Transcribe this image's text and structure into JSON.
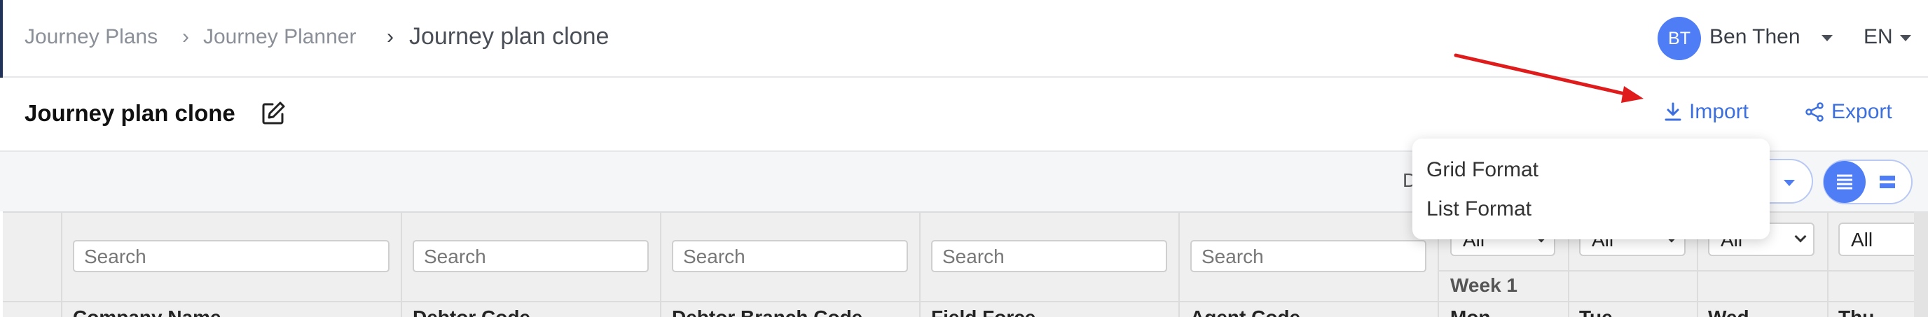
{
  "breadcrumb": {
    "items": [
      "Journey Plans",
      "Journey Planner"
    ],
    "current": "Journey plan clone"
  },
  "user": {
    "initials": "BT",
    "name": "Ben Then"
  },
  "language": "EN",
  "page": {
    "title": "Journey plan clone"
  },
  "actions": {
    "import_label": "Import",
    "export_label": "Export"
  },
  "toolbar": {
    "partial_label": "D"
  },
  "import_menu": {
    "items": [
      "Grid Format",
      "List Format"
    ]
  },
  "table": {
    "search_placeholder": "Search",
    "columns": [
      "Company Name",
      "Debtor Code",
      "Debtor Branch Code",
      "Field Force",
      "Agent Code"
    ],
    "filter_selects": [
      "All",
      "All",
      "All",
      "All"
    ],
    "week_label": "Week 1",
    "day_columns": [
      "Mon",
      "Tue",
      "Wed",
      "Thu"
    ]
  },
  "colors": {
    "accent": "#4f7df5",
    "link": "#3b6fe0",
    "annotation_arrow": "#e01b1b"
  }
}
